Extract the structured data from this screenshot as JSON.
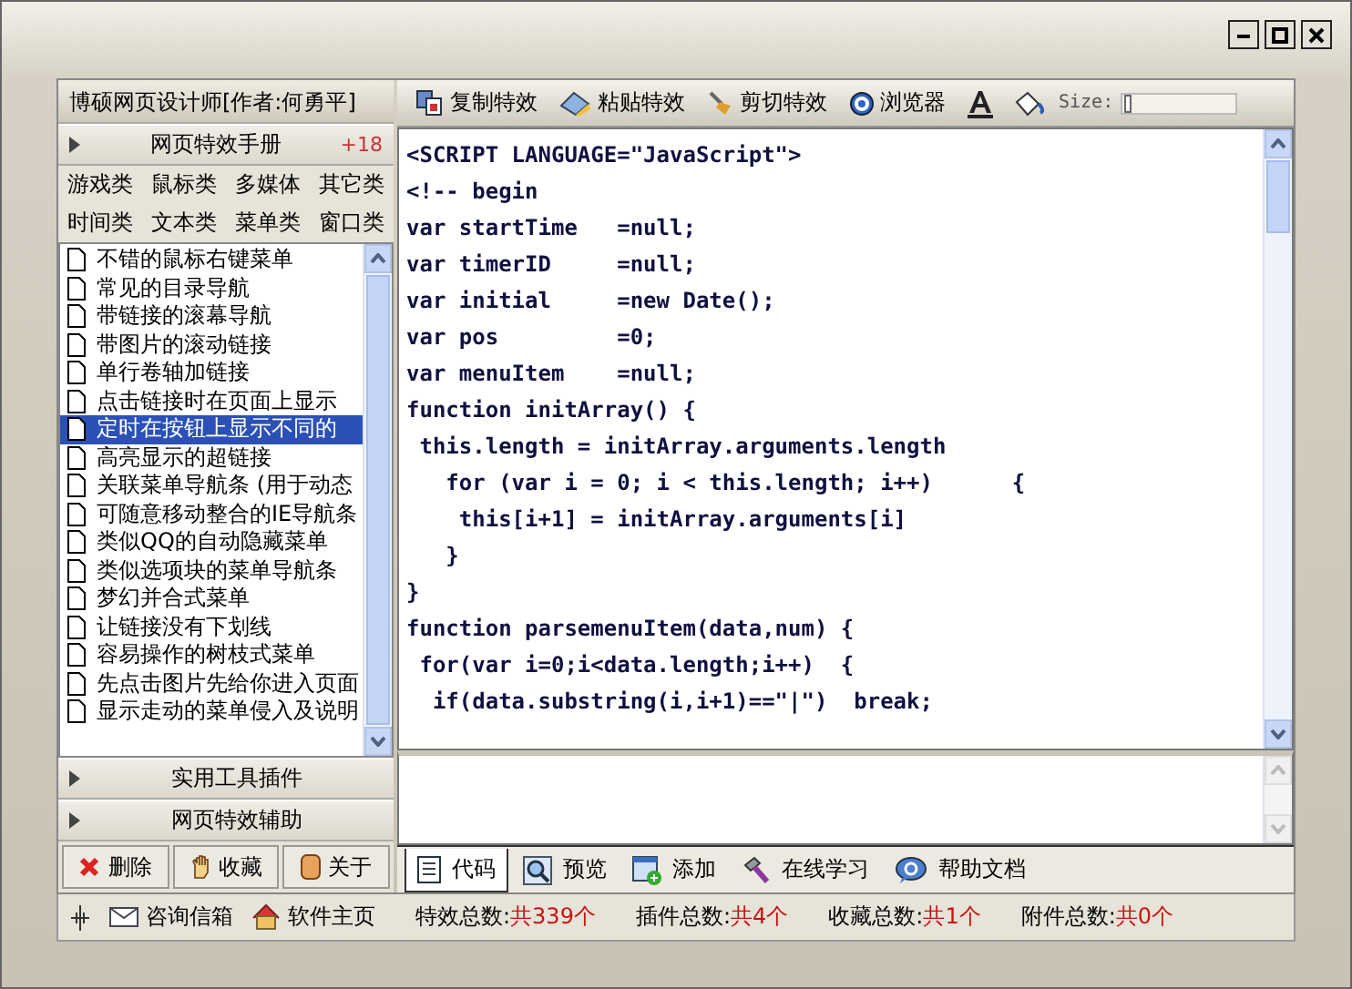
{
  "app_title": "博硕网页设计师[作者:何勇平]",
  "sections": [
    {
      "label": "网页特效手册",
      "badge": "+18"
    },
    {
      "label": "实用工具插件"
    },
    {
      "label": "网页特效辅助"
    }
  ],
  "categories": [
    "游戏类",
    "鼠标类",
    "多媒体",
    "其它类",
    "时间类",
    "文本类",
    "菜单类",
    "窗口类"
  ],
  "effects": [
    {
      "label": "不错的鼠标右键菜单",
      "selected": false
    },
    {
      "label": "常见的目录导航",
      "selected": false
    },
    {
      "label": "带链接的滚幕导航",
      "selected": false
    },
    {
      "label": "带图片的滚动链接",
      "selected": false
    },
    {
      "label": "单行卷轴加链接",
      "selected": false
    },
    {
      "label": "点击链接时在页面上显示",
      "selected": false
    },
    {
      "label": "定时在按钮上显示不同的",
      "selected": true
    },
    {
      "label": "高亮显示的超链接",
      "selected": false
    },
    {
      "label": "关联菜单导航条 (用于动态",
      "selected": false
    },
    {
      "label": "可随意移动整合的IE导航条",
      "selected": false
    },
    {
      "label": "类似QQ的自动隐藏菜单",
      "selected": false
    },
    {
      "label": "类似选项块的菜单导航条",
      "selected": false
    },
    {
      "label": "梦幻并合式菜单",
      "selected": false
    },
    {
      "label": "让链接没有下划线",
      "selected": false
    },
    {
      "label": "容易操作的树枝式菜单",
      "selected": false
    },
    {
      "label": "先点击图片先给你进入页面",
      "selected": false
    },
    {
      "label": "显示走动的菜单侵入及说明",
      "selected": false
    }
  ],
  "left_buttons": [
    {
      "kind": "delete",
      "label": "删除"
    },
    {
      "kind": "favorite",
      "label": "收藏"
    },
    {
      "kind": "about",
      "label": "关于"
    }
  ],
  "toolbar": [
    {
      "kind": "copy",
      "label": "复制特效"
    },
    {
      "kind": "paste",
      "label": "粘贴特效"
    },
    {
      "kind": "cut",
      "label": "剪切特效"
    },
    {
      "kind": "browser",
      "label": "浏览器"
    }
  ],
  "size_slider": {
    "label": "Size:",
    "level": 0.02
  },
  "code_lines": [
    "<SCRIPT LANGUAGE=\"JavaScript\">",
    "<!-- begin",
    "var startTime   =null;",
    "var timerID     =null;",
    "var initial     =new Date();",
    "var pos         =0;",
    "var menuItem    =null;",
    "function initArray() {",
    " this.length = initArray.arguments.length",
    "   for (var i = 0; i < this.length; i++)      {",
    "    this[i+1] = initArray.arguments[i]",
    "   }",
    "}",
    "function parsemenuItem(data,num) {",
    " for(var i=0;i<data.length;i++)  {",
    "  if(data.substring(i,i+1)==\"|\")  break;"
  ],
  "bottom_tabs": [
    {
      "kind": "code",
      "label": "代码",
      "selected": true
    },
    {
      "kind": "preview",
      "label": "预览",
      "selected": false
    },
    {
      "kind": "add",
      "label": "添加",
      "selected": false
    },
    {
      "kind": "learn",
      "label": "在线学习",
      "selected": false
    },
    {
      "kind": "help",
      "label": "帮助文档",
      "selected": false
    }
  ],
  "status_links": [
    {
      "kind": "mail",
      "label": "咨询信箱"
    },
    {
      "kind": "home",
      "label": "软件主页"
    }
  ],
  "status_counts": [
    {
      "label": "特效总数:",
      "value": "共339个"
    },
    {
      "label": "插件总数:",
      "value": "共4个"
    },
    {
      "label": "收藏总数:",
      "value": "共1个"
    },
    {
      "label": "附件总数:",
      "value": "共0个"
    }
  ]
}
